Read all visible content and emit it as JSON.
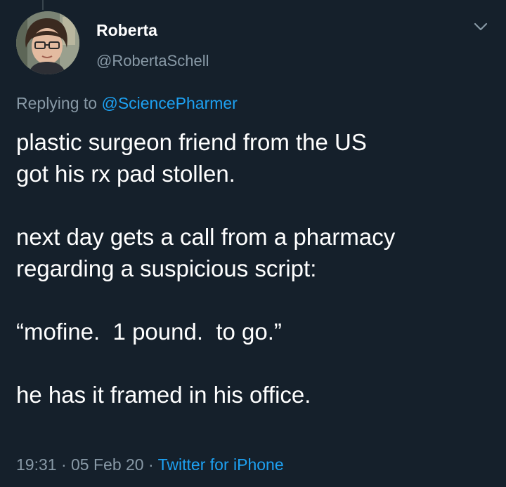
{
  "tweet": {
    "author": {
      "display_name": "Roberta",
      "handle": "@RobertaSchell",
      "avatar_icon": "profile-photo-avatar"
    },
    "reply": {
      "prefix": "Replying to",
      "mention": "@SciencePharmer"
    },
    "body": [
      "plastic surgeon friend from the US",
      "got his rx pad stollen.",
      "",
      "next day gets a call from a pharmacy",
      "regarding a suspicious script:",
      "",
      "“mofine.  1 pound.  to go.”",
      "",
      "he has it framed in his office."
    ],
    "meta": {
      "time": "19:31",
      "separator": "·",
      "date": "05 Feb 20",
      "source": "Twitter for iPhone"
    }
  },
  "colors": {
    "background": "#15202b",
    "text_primary": "#ffffff",
    "text_secondary": "#8899a6",
    "accent": "#1da1f2"
  },
  "icons": {
    "menu": "chevron-down-icon"
  }
}
